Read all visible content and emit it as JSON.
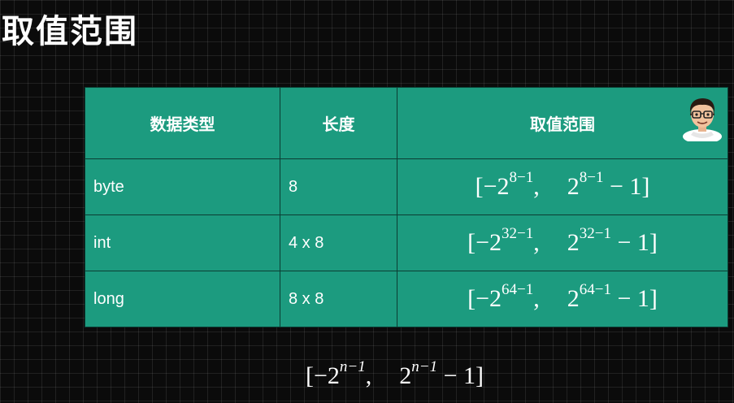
{
  "title": "取值范围",
  "table": {
    "headers": [
      "数据类型",
      "长度",
      "取值范围"
    ],
    "rows": [
      {
        "type": "byte",
        "length": "8",
        "exp": "8−1"
      },
      {
        "type": "int",
        "length": "4 x 8",
        "exp": "32−1"
      },
      {
        "type": "long",
        "length": "8 x 8",
        "exp": "64−1"
      }
    ]
  },
  "math": {
    "open": "[",
    "close": "]",
    "neg_two": "−2",
    "two": "2",
    "minus_one": " − 1",
    "comma": ","
  },
  "general_formula": {
    "exp": "n−1"
  },
  "colors": {
    "table_bg": "#1c9b7f",
    "border": "#0b3d33",
    "background": "#0b0b0b"
  },
  "icons": {
    "avatar": "cartoon-person-with-glasses-icon"
  }
}
